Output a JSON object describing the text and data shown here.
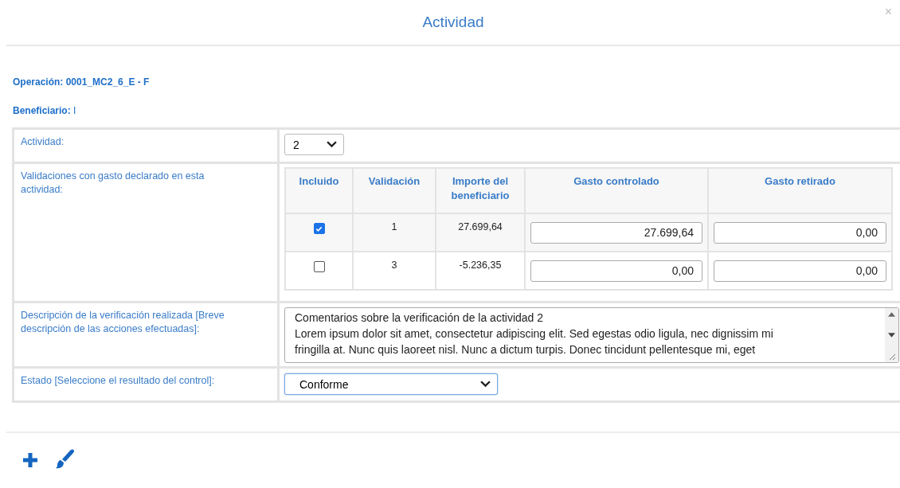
{
  "dialog": {
    "title": "Actividad",
    "close": "×"
  },
  "operacion": {
    "label": "Operación:",
    "value": "0001_MC2_6_E - F"
  },
  "beneficiario": {
    "label": "Beneficiario:",
    "value": "I"
  },
  "form": {
    "actividad": {
      "label": "Actividad:",
      "value": "2"
    },
    "validaciones": {
      "label": "Validaciones con gasto declarado en esta actividad:",
      "columns": [
        "Incluido",
        "Validación",
        "Importe del beneficiario",
        "Gasto controlado",
        "Gasto retirado"
      ],
      "rows": [
        {
          "checked": true,
          "validacion": "1",
          "importe": "27.699,64",
          "gasto_controlado": "27.699,64",
          "gasto_retirado": "0,00"
        },
        {
          "checked": false,
          "validacion": "3",
          "importe": "-5.236,35",
          "gasto_controlado": "0,00",
          "gasto_retirado": "0,00"
        }
      ]
    },
    "descripcion": {
      "label": "Descripción de la verificación realizada [Breve descripción de las acciones efectuadas]:",
      "lines": [
        "Comentarios sobre la verificación de la actividad 2",
        "Lorem ipsum dolor sit amet, consectetur adipiscing elit. Sed egestas odio ligula, nec dignissim mi",
        "fringilla at. Nunc quis laoreet nisl. Nunc a dictum turpis. Donec tincidunt pellentesque mi, eget"
      ]
    },
    "estado": {
      "label": "Estado [Seleccione el resultado del control]:",
      "value": "Conforme"
    }
  }
}
